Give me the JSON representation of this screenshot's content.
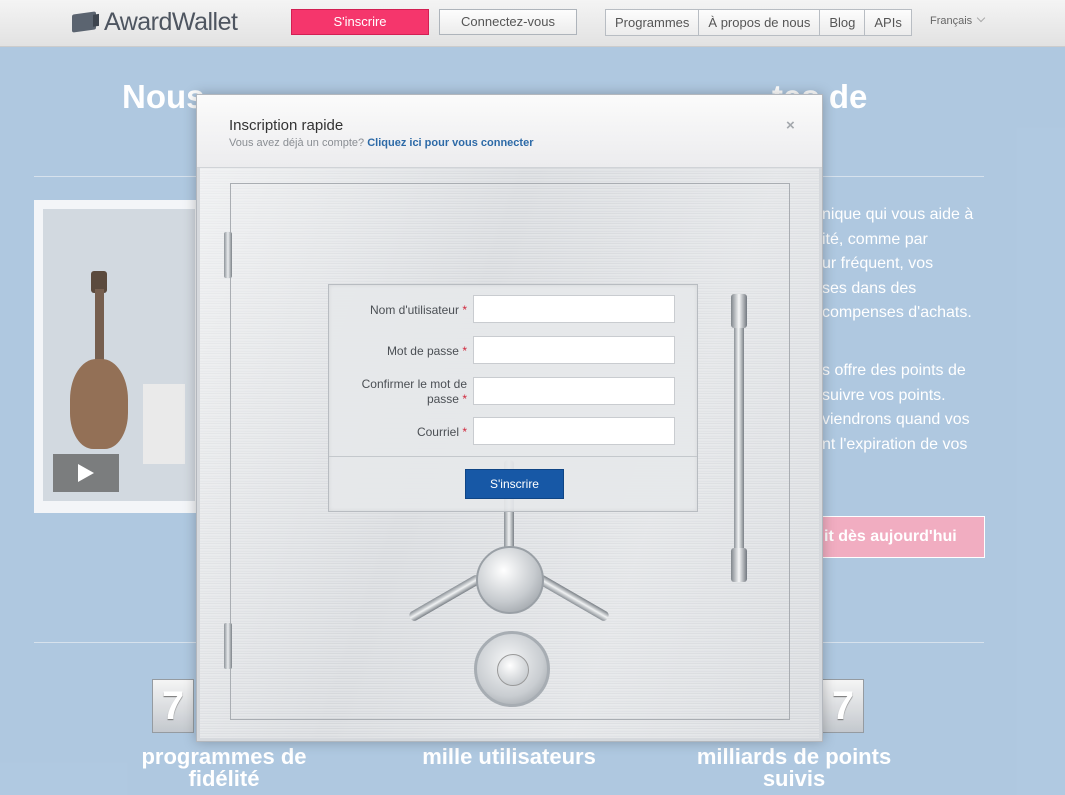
{
  "header": {
    "logo_text": "AwardWallet",
    "signup_label": "S'inscrire",
    "login_label": "Connectez-vous",
    "nav": [
      "Programmes",
      "À propos de nous",
      "Blog",
      "APIs"
    ],
    "language": "Français"
  },
  "page": {
    "hero_left": "Nous",
    "hero_right": "tes de",
    "side_text_1": [
      "nique qui vous aide à",
      "ité, comme par",
      "ur fréquent, vos",
      "ses dans des",
      "compenses d'achats."
    ],
    "side_text_2": [
      "s offre des points de",
      "suivre vos points.",
      "viendrons quand vos",
      "nt l'expiration de vos"
    ],
    "cta": "it dès aujourd'hui",
    "counter_left": "7",
    "counter_right": "7",
    "stat_1": [
      "programmes de",
      "fidélité"
    ],
    "stat_2": "mille utilisateurs",
    "stat_3": [
      "milliards de points",
      "suivis"
    ]
  },
  "modal": {
    "title": "Inscription rapide",
    "subtitle_prefix": "Vous avez déjà un compte?",
    "subtitle_link": "Cliquez ici pour vous connecter",
    "close": "×",
    "fields": {
      "username_label": "Nom d'utilisateur",
      "password_label": "Mot de passe",
      "confirm_label_1": "Confirmer le mot de",
      "confirm_label_2": "passe",
      "email_label": "Courriel",
      "required_mark": "*"
    },
    "submit_label": "S'inscrire"
  }
}
